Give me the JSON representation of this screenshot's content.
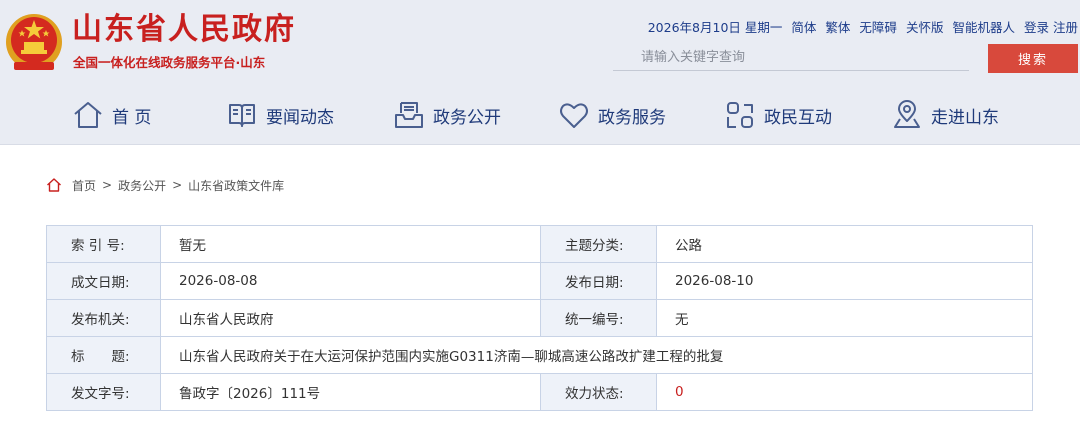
{
  "header": {
    "site_title": "山东省人民政府",
    "site_subtitle": "全国一体化在线政务服务平台·山东",
    "date": "2026年8月10日 星期一",
    "links": [
      "简体",
      "繁体",
      "无障碍",
      "关怀版",
      "智能机器人",
      "登录",
      "注册"
    ],
    "search_placeholder": "请输入关键字查询",
    "search_button": "搜索"
  },
  "nav": [
    {
      "label": "首 页",
      "icon": "home-icon"
    },
    {
      "label": "要闻动态",
      "icon": "book-icon"
    },
    {
      "label": "政务公开",
      "icon": "inbox-icon"
    },
    {
      "label": "政务服务",
      "icon": "heart-icon"
    },
    {
      "label": "政民互动",
      "icon": "interact-icon"
    },
    {
      "label": "走进山东",
      "icon": "location-icon"
    }
  ],
  "breadcrumb": [
    "首页",
    ">",
    "政务公开",
    ">",
    "山东省政策文件库"
  ],
  "info": {
    "index_label": "索 引 号:",
    "index_value": "暂无",
    "topic_label": "主题分类:",
    "topic_value": "公路",
    "written_label": "成文日期:",
    "written_value": "2026-08-08",
    "publish_label": "发布日期:",
    "publish_value": "2026-08-10",
    "issuer_label": "发布机关:",
    "issuer_value": "山东省人民政府",
    "uniform_label": "统一编号:",
    "uniform_value": "无",
    "title_label": "标　　题:",
    "title_value": "山东省人民政府关于在大运河保护范围内实施G0311济南—聊城高速公路改扩建工程的批复",
    "docno_label": "发文字号:",
    "docno_value": "鲁政字〔2026〕111号",
    "status_label": "效力状态:",
    "status_value": "0"
  },
  "colors": {
    "brand_red": "#c8201f",
    "nav_blue": "#1f3a7a",
    "search_btn": "#d8493c",
    "header_bg": "#e9ecf3"
  }
}
